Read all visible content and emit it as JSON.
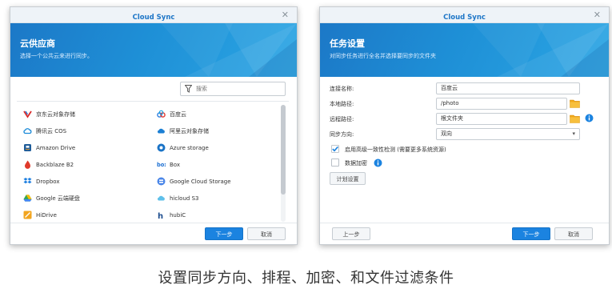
{
  "left_window": {
    "title": "Cloud Sync",
    "close_glyph": "✕",
    "banner_title": "云供应商",
    "banner_subtitle": "选择一个公共云来进行同步。",
    "search_placeholder": "搜索",
    "providers": [
      [
        "京东云对象存储",
        "百度云"
      ],
      [
        "腾讯云 COS",
        "阿里云对象存储"
      ],
      [
        "Amazon Drive",
        "Azure storage"
      ],
      [
        "Backblaze B2",
        "Box"
      ],
      [
        "Dropbox",
        "Google Cloud Storage"
      ],
      [
        "Google 云端硬盘",
        "hicloud S3"
      ],
      [
        "HiDrive",
        "hubiC"
      ]
    ],
    "provider_icons": [
      [
        "jdcloud-icon",
        "baidu-cloud-icon"
      ],
      [
        "tencent-cloud-icon",
        "aliyun-icon"
      ],
      [
        "amazon-drive-icon",
        "azure-icon"
      ],
      [
        "backblaze-icon",
        "box-icon"
      ],
      [
        "dropbox-icon",
        "google-cloud-storage-icon"
      ],
      [
        "google-drive-icon",
        "hicloud-icon"
      ],
      [
        "hidrive-icon",
        "hubic-icon"
      ]
    ],
    "next_label": "下一步",
    "cancel_label": "取消"
  },
  "right_window": {
    "title": "Cloud Sync",
    "close_glyph": "✕",
    "banner_title": "任务设置",
    "banner_subtitle": "对同步任务进行全名并选择要同步的文件夹",
    "fields": {
      "connection_name_label": "连接名称:",
      "connection_name_value": "百度云",
      "local_path_label": "本地路径:",
      "local_path_value": "/photo",
      "remote_path_label": "远程路径:",
      "remote_path_value": "根文件夹",
      "sync_direction_label": "同步方向:",
      "sync_direction_value": "双向"
    },
    "consistency_check_label": "启用高级一致性检测 (需要更多系统资源)",
    "consistency_check_checked": true,
    "encrypt_label": "数据加密",
    "encrypt_checked": false,
    "schedule_label": "计划设置",
    "back_label": "上一步",
    "next_label": "下一步",
    "cancel_label": "取消"
  },
  "caption": "设置同步方向、排程、加密、和文件过滤条件",
  "colors": {
    "accent": "#1b83e0",
    "title_blue": "#1e76c7",
    "banner_start": "#1c78c7",
    "banner_end": "#2ba6e4",
    "folder_orange": "#f2a91a",
    "check_blue": "#1b83e0"
  }
}
